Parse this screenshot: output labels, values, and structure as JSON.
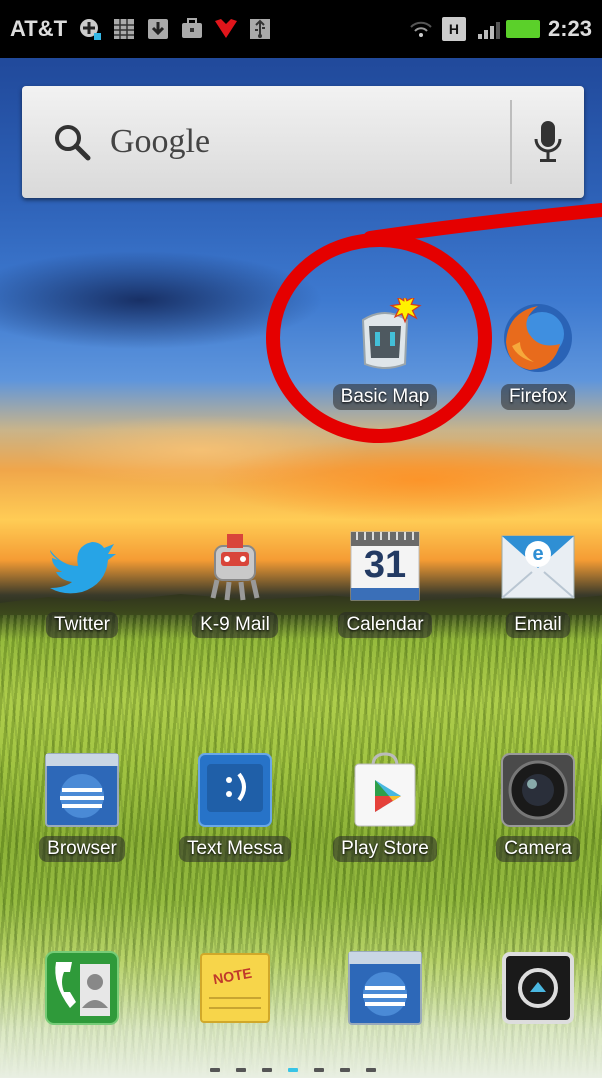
{
  "status_bar": {
    "carrier": "AT&T",
    "clock": "2:23",
    "network_badge": "H",
    "icons": [
      "plus-notification-icon",
      "calendar-notification-icon",
      "download-notification-icon",
      "briefcase-notification-icon",
      "heart-notification-icon",
      "usb-notification-icon",
      "wifi-icon",
      "hspa-icon",
      "signal-icon",
      "battery-icon"
    ],
    "colors": {
      "battery": "#5bd02a"
    }
  },
  "search_widget": {
    "label": "Google"
  },
  "apps": [
    {
      "label": "Basic Map",
      "icon": "android-app-icon",
      "highlighted": true
    },
    {
      "label": "Firefox",
      "icon": "firefox-icon"
    },
    {
      "label": "Twitter",
      "icon": "twitter-icon"
    },
    {
      "label": "K-9 Mail",
      "icon": "k9-mail-icon"
    },
    {
      "label": "Calendar",
      "icon": "calendar-icon",
      "date": "31"
    },
    {
      "label": "Email",
      "icon": "email-icon"
    },
    {
      "label": "Browser",
      "icon": "browser-icon"
    },
    {
      "label": "Text Messa",
      "icon": "text-message-icon"
    },
    {
      "label": "Play Store",
      "icon": "play-store-icon"
    },
    {
      "label": "Camera",
      "icon": "camera-icon"
    }
  ],
  "dock": [
    {
      "icon": "phone-dialer-icon"
    },
    {
      "icon": "note-icon",
      "text": "NOTE"
    },
    {
      "icon": "browser-icon"
    },
    {
      "icon": "app-drawer-icon"
    }
  ],
  "page_indicator": {
    "pages": 7,
    "current": 4,
    "colors": {
      "active": "#38c4e6"
    }
  },
  "annotation": {
    "color": "#e50000"
  }
}
